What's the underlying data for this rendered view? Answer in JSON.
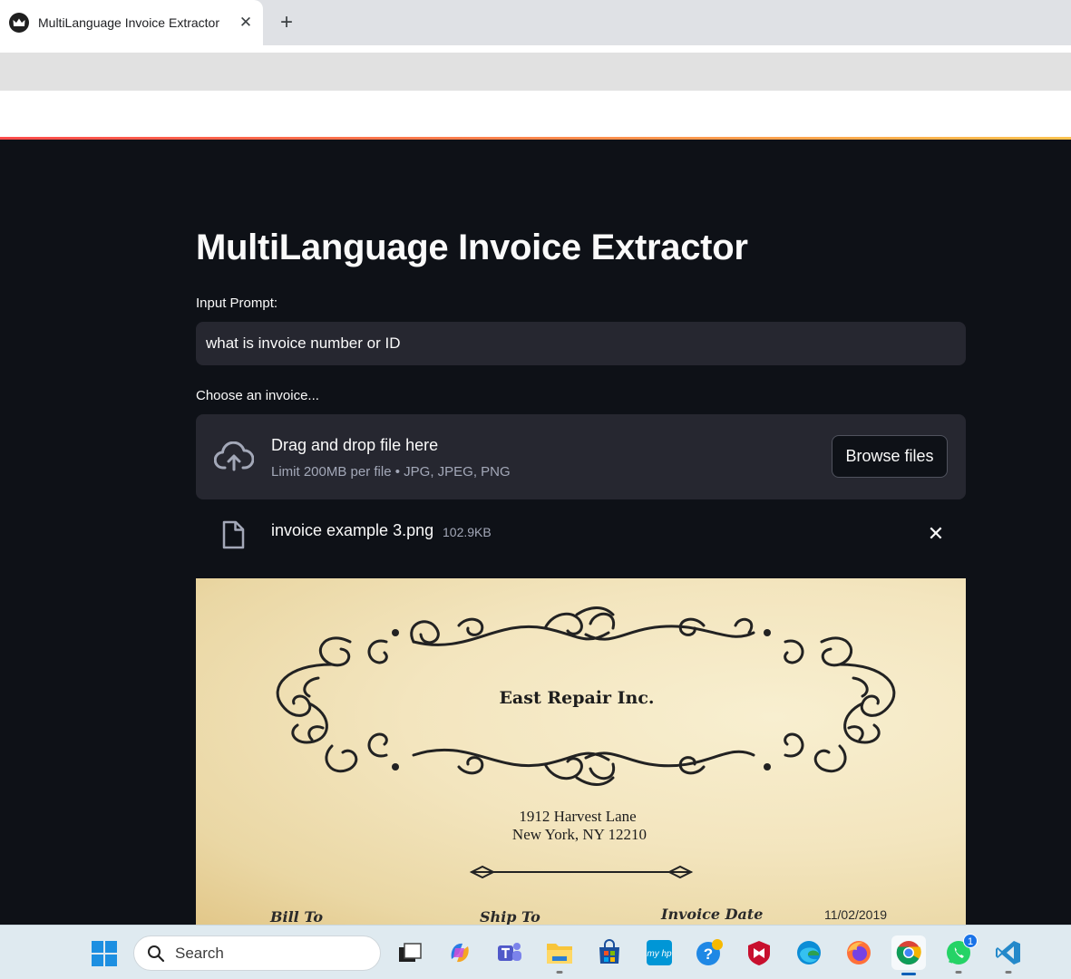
{
  "browser": {
    "tab_title": "MultiLanguage Invoice Extractor",
    "tab_close": "✕",
    "new_tab": "+"
  },
  "app": {
    "title": "MultiLanguage Invoice Extractor",
    "prompt_label": "Input Prompt:",
    "prompt_value": "what is invoice number or ID",
    "uploader_label": "Choose an invoice...",
    "dropzone_title": "Drag and drop file here",
    "dropzone_subtitle": "Limit 200MB per file • JPG, JPEG, PNG",
    "browse_label": "Browse files",
    "file_name": "invoice example 3.png",
    "file_size": "102.9KB",
    "file_remove": "✕"
  },
  "invoice": {
    "company": "East Repair Inc.",
    "address_line1": "1912 Harvest Lane",
    "address_line2": "New York, NY 12210",
    "bill_to": "Bill To",
    "ship_to": "Ship To",
    "invoice_date_label": "Invoice Date",
    "invoice_date_value": "11/02/2019"
  },
  "taskbar": {
    "search_placeholder": "Search",
    "whatsapp_badge": "1"
  },
  "colors": {
    "app_background": "#0e1117",
    "input_background": "#262730",
    "text_primary": "#fafafa",
    "text_muted": "#a3a8b8",
    "accent_gradient_start": "#ff4b4b",
    "accent_gradient_end": "#fdc34f"
  }
}
